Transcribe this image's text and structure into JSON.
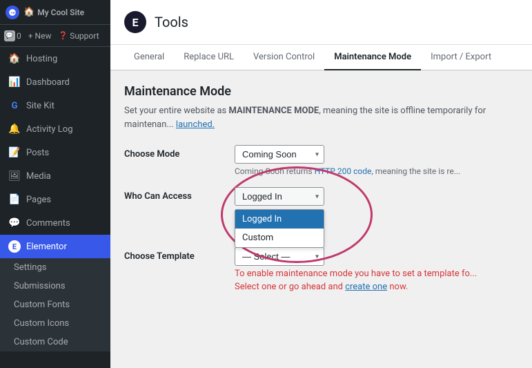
{
  "site": {
    "name": "My Cool Site",
    "logo_label": "W"
  },
  "topbar": {
    "comments_count": "0",
    "new_label": "+ New",
    "support_label": "Support"
  },
  "sidebar": {
    "items": [
      {
        "id": "hosting",
        "label": "Hosting",
        "icon": "🏠"
      },
      {
        "id": "dashboard",
        "label": "Dashboard",
        "icon": "📊"
      },
      {
        "id": "site-kit",
        "label": "Site Kit",
        "icon": "G"
      },
      {
        "id": "activity-log",
        "label": "Activity Log",
        "icon": "🔔"
      },
      {
        "id": "posts",
        "label": "Posts",
        "icon": "📝"
      },
      {
        "id": "media",
        "label": "Media",
        "icon": "🖼"
      },
      {
        "id": "pages",
        "label": "Pages",
        "icon": "📄"
      },
      {
        "id": "comments",
        "label": "Comments",
        "icon": "💬"
      },
      {
        "id": "elementor",
        "label": "Elementor",
        "icon": "E",
        "active": true
      }
    ],
    "sub_items": [
      {
        "id": "settings",
        "label": "Settings"
      },
      {
        "id": "submissions",
        "label": "Submissions"
      },
      {
        "id": "custom-fonts",
        "label": "Custom Fonts"
      },
      {
        "id": "custom-icons",
        "label": "Custom Icons"
      },
      {
        "id": "custom-code",
        "label": "Custom Code"
      }
    ]
  },
  "page": {
    "icon_label": "E",
    "title": "Tools"
  },
  "tabs": [
    {
      "id": "general",
      "label": "General"
    },
    {
      "id": "replace-url",
      "label": "Replace URL"
    },
    {
      "id": "version-control",
      "label": "Version Control"
    },
    {
      "id": "maintenance-mode",
      "label": "Maintenance Mode",
      "active": true
    },
    {
      "id": "import-export",
      "label": "Import / Export"
    }
  ],
  "maintenance_mode": {
    "title": "Maintenance Mode",
    "description": "Set your entire website as MAINTENANCE MODE, meaning the site is offline temporarily for maintenan... launched.",
    "choose_mode_label": "Choose Mode",
    "mode_value": "Coming Soon",
    "mode_help": "Coming Soon returns HTTP 200 code, meaning the site is re...",
    "who_can_access_label": "Who Can Access",
    "access_value": "Logged In",
    "access_options": [
      {
        "value": "logged-in",
        "label": "Logged In",
        "selected": true
      },
      {
        "value": "custom",
        "label": "Custom"
      }
    ],
    "choose_template_label": "Choose Template",
    "template_value": "— Select —",
    "template_error": "To enable maintenance mode you have to set a template fo...",
    "template_create": "Select one or go ahead and",
    "template_create_link": "create one",
    "template_create_after": "now."
  }
}
